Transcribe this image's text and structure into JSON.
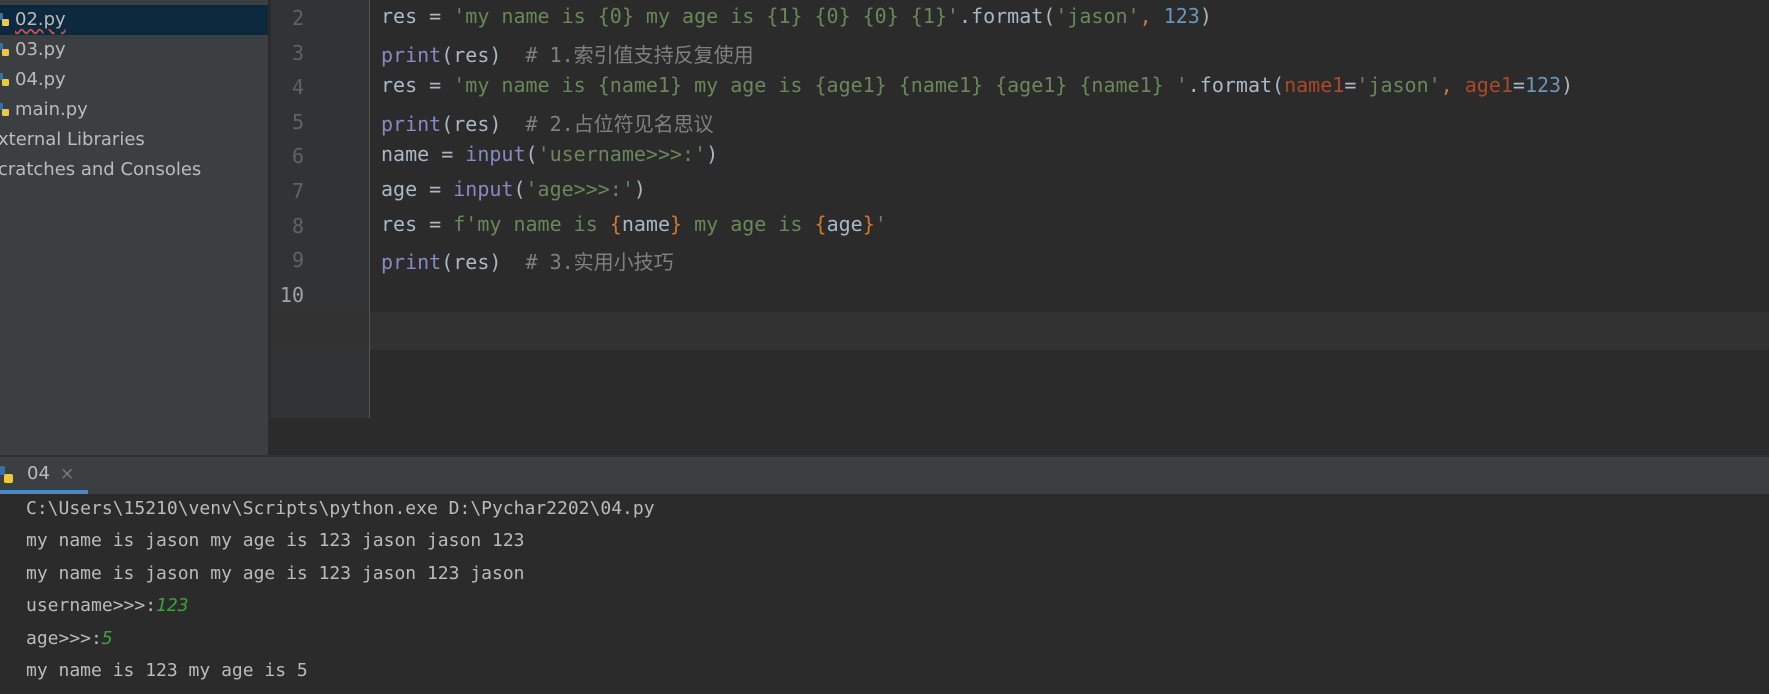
{
  "project_tree": {
    "items": [
      {
        "label": "02.py",
        "selected": true
      },
      {
        "label": "03.py"
      },
      {
        "label": "04.py"
      },
      {
        "label": "main.py"
      },
      {
        "label": "xternal Libraries"
      },
      {
        "label": "cratches and Consoles"
      }
    ]
  },
  "editor": {
    "lines": [
      {
        "num": "2",
        "tokens": [
          {
            "t": "res = ",
            "c": "plain"
          },
          {
            "t": "'my name is {0} my age is {1} {0} {0} {1}'",
            "c": "str"
          },
          {
            "t": ".format(",
            "c": "plain"
          },
          {
            "t": "'jason'",
            "c": "str"
          },
          {
            "t": ", ",
            "c": "brace"
          },
          {
            "t": "123",
            "c": "num"
          },
          {
            "t": ")",
            "c": "plain"
          }
        ]
      },
      {
        "num": "3",
        "tokens": [
          {
            "t": "print",
            "c": "kw"
          },
          {
            "t": "(res)  ",
            "c": "plain"
          },
          {
            "t": "# 1.索引值支持反复使用",
            "c": "cmt"
          }
        ]
      },
      {
        "num": "4",
        "tokens": [
          {
            "t": "res = ",
            "c": "plain"
          },
          {
            "t": "'my name is {name1} my age is {age1} {name1} {age1} {name1} '",
            "c": "str"
          },
          {
            "t": ".format(",
            "c": "plain"
          },
          {
            "t": "name1",
            "c": "param"
          },
          {
            "t": "=",
            "c": "plain"
          },
          {
            "t": "'jason'",
            "c": "str"
          },
          {
            "t": ", ",
            "c": "brace"
          },
          {
            "t": "age1",
            "c": "param"
          },
          {
            "t": "=",
            "c": "plain"
          },
          {
            "t": "123",
            "c": "num"
          },
          {
            "t": ")",
            "c": "plain"
          }
        ]
      },
      {
        "num": "5",
        "tokens": [
          {
            "t": "print",
            "c": "kw"
          },
          {
            "t": "(res)  ",
            "c": "plain"
          },
          {
            "t": "# 2.占位符见名思议",
            "c": "cmt"
          }
        ]
      },
      {
        "num": "6",
        "tokens": [
          {
            "t": "name = ",
            "c": "plain"
          },
          {
            "t": "input",
            "c": "kw"
          },
          {
            "t": "(",
            "c": "plain"
          },
          {
            "t": "'username>>>:'",
            "c": "str"
          },
          {
            "t": ")",
            "c": "plain"
          }
        ]
      },
      {
        "num": "7",
        "tokens": [
          {
            "t": "age = ",
            "c": "plain"
          },
          {
            "t": "input",
            "c": "kw"
          },
          {
            "t": "(",
            "c": "plain"
          },
          {
            "t": "'age>>>:'",
            "c": "str"
          },
          {
            "t": ")",
            "c": "plain"
          }
        ]
      },
      {
        "num": "8",
        "tokens": [
          {
            "t": "res = ",
            "c": "plain"
          },
          {
            "t": "f'my name is ",
            "c": "str"
          },
          {
            "t": "{",
            "c": "brace"
          },
          {
            "t": "name",
            "c": "plain"
          },
          {
            "t": "}",
            "c": "brace"
          },
          {
            "t": " my age is ",
            "c": "str"
          },
          {
            "t": "{",
            "c": "brace"
          },
          {
            "t": "age",
            "c": "plain"
          },
          {
            "t": "}",
            "c": "brace"
          },
          {
            "t": "'",
            "c": "str"
          }
        ]
      },
      {
        "num": "9",
        "tokens": [
          {
            "t": "print",
            "c": "kw"
          },
          {
            "t": "(res)  ",
            "c": "plain"
          },
          {
            "t": "# 3.实用小技巧",
            "c": "cmt"
          }
        ]
      },
      {
        "num": "10",
        "tokens": [],
        "active": true
      }
    ]
  },
  "run_panel": {
    "tab_label": "04",
    "close_glyph": "×",
    "output": [
      {
        "text": "C:\\Users\\15210\\venv\\Scripts\\python.exe D:\\Pychar2202\\04.py"
      },
      {
        "text": "my name is jason my age is 123 jason jason 123"
      },
      {
        "text": "my name is jason my age is 123 jason 123 jason"
      },
      {
        "text": "username>>>:",
        "input": "123"
      },
      {
        "text": "age>>>:",
        "input": "5"
      },
      {
        "text": "my name is 123 my age is 5"
      }
    ]
  },
  "colors": {
    "keyword": "#8888c6",
    "string": "#6a8759",
    "number": "#6897bb",
    "comment": "#808080",
    "param": "#aa4926",
    "brace": "#cc7832",
    "user_input": "#3ba33b",
    "selection": "#0d293e"
  },
  "icons": {
    "file": "python-file-icon",
    "run_tab": "python-run-icon"
  }
}
